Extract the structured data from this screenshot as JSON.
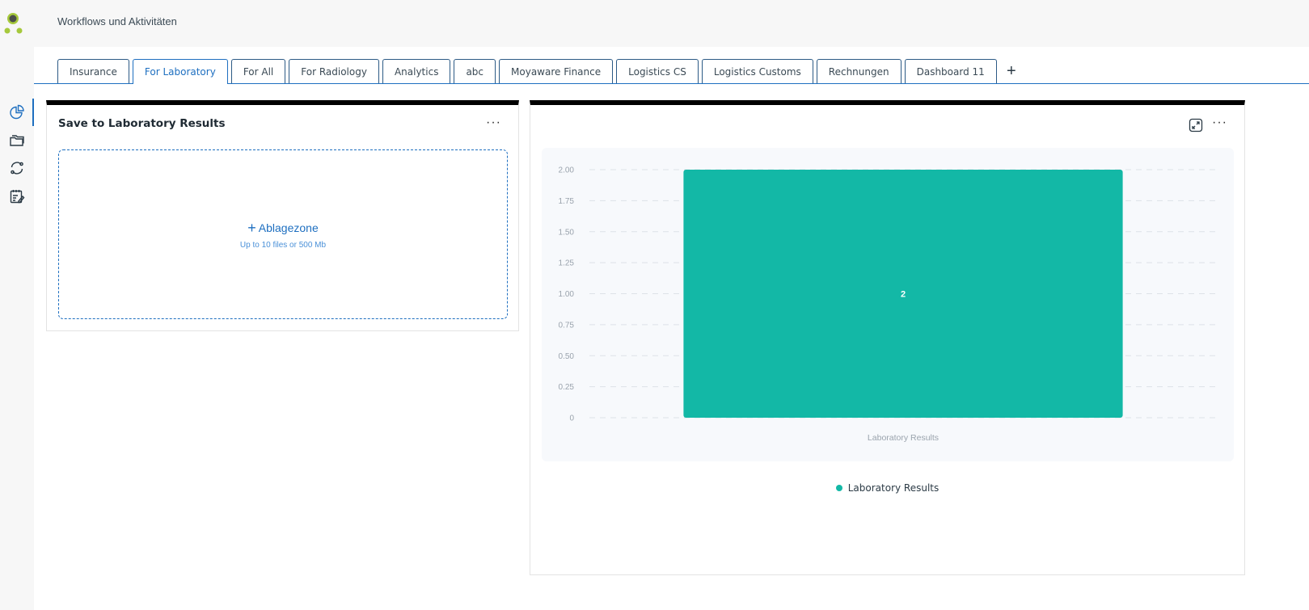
{
  "header": {
    "title": "Workflows und Aktivitäten"
  },
  "logo": {
    "colors": [
      "#4b4f4a",
      "#a6c93c",
      "#a6c93c"
    ],
    "ring": "#a6c93c"
  },
  "rail": {
    "items": [
      {
        "icon": "pie-chart-icon",
        "active": true
      },
      {
        "icon": "folder-icon",
        "active": false
      },
      {
        "icon": "sync-icon",
        "active": false
      },
      {
        "icon": "task-list-icon",
        "active": false
      }
    ]
  },
  "tabs": [
    {
      "label": "Insurance",
      "active": false
    },
    {
      "label": "For Laboratory",
      "active": true
    },
    {
      "label": "For All",
      "active": false
    },
    {
      "label": "For Radiology",
      "active": false
    },
    {
      "label": "Analytics",
      "active": false
    },
    {
      "label": "abc",
      "active": false
    },
    {
      "label": "Moyaware Finance",
      "active": false
    },
    {
      "label": "Logistics CS",
      "active": false
    },
    {
      "label": "Logistics Customs",
      "active": false
    },
    {
      "label": "Rechnungen",
      "active": false
    },
    {
      "label": "Dashboard 11",
      "active": false
    }
  ],
  "tab_add_label": "+",
  "upload_card": {
    "title": "Save to Laboratory Results",
    "menu_label": "···",
    "dropzone_plus": "+",
    "dropzone_label": "Ablagezone",
    "dropzone_hint": "Up to 10 files or 500 Mb"
  },
  "chart_card": {
    "menu_label": "···",
    "accent_color": "#13b8a6"
  },
  "chart_data": {
    "type": "bar",
    "categories": [
      "Laboratory Results"
    ],
    "series": [
      {
        "name": "Laboratory Results",
        "values": [
          2
        ]
      }
    ],
    "data_labels": [
      "2"
    ],
    "ylim": [
      0,
      2
    ],
    "yticks": [
      "0",
      "0.25",
      "0.50",
      "0.75",
      "1.00",
      "1.25",
      "1.50",
      "1.75",
      "2.00"
    ],
    "grid": true,
    "legend": "bottom-center",
    "color": "#13b8a6"
  }
}
